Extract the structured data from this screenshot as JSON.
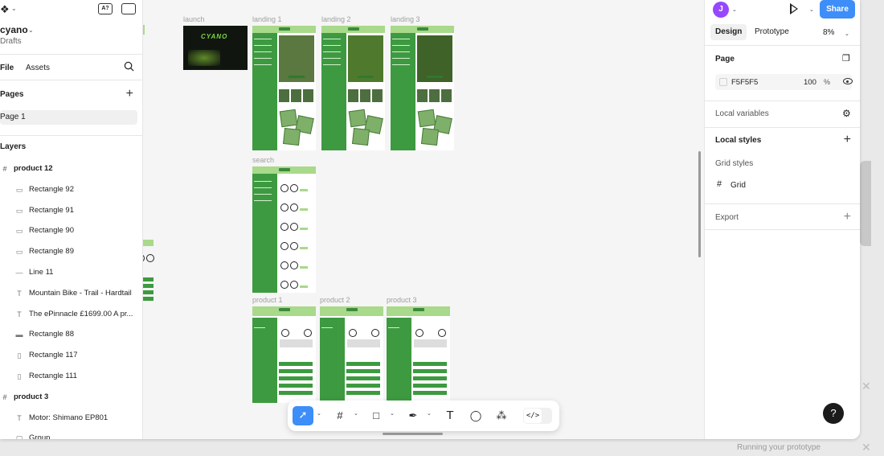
{
  "left": {
    "logo_glyph": "figma-logo",
    "file_name": "cyano",
    "file_location": "Drafts",
    "tabs": [
      "File",
      "Assets"
    ],
    "pages_heading": "Pages",
    "pages": [
      "Page 1"
    ],
    "layers_heading": "Layers",
    "layers": [
      {
        "kind": "frame",
        "icon": "#",
        "name": "product 12"
      },
      {
        "kind": "rect",
        "icon": "▭",
        "name": "Rectangle 92"
      },
      {
        "kind": "rect",
        "icon": "▭",
        "name": "Rectangle 91"
      },
      {
        "kind": "rect",
        "icon": "▭",
        "name": "Rectangle 90"
      },
      {
        "kind": "rect",
        "icon": "▭",
        "name": "Rectangle 89"
      },
      {
        "kind": "line",
        "icon": "—",
        "name": "Line 11"
      },
      {
        "kind": "text",
        "icon": "T",
        "name": "Mountain Bike - Trail - Hardtail"
      },
      {
        "kind": "text",
        "icon": "T",
        "name": "The ePinnacle £1699.00  A pr..."
      },
      {
        "kind": "rect",
        "icon": "▬",
        "name": "Rectangle 88"
      },
      {
        "kind": "rect",
        "icon": "▯",
        "name": "Rectangle 117"
      },
      {
        "kind": "rect",
        "icon": "▯",
        "name": "Rectangle 111"
      },
      {
        "kind": "frame",
        "icon": "#",
        "name": "product 3"
      },
      {
        "kind": "text",
        "icon": "T",
        "name": "Motor: Shimano EP801"
      },
      {
        "kind": "group",
        "icon": "▢",
        "name": "Group"
      }
    ]
  },
  "canvas": {
    "frames": {
      "launch": "launch",
      "landing1": "landing 1",
      "landing2": "landing 2",
      "landing3": "landing 3",
      "search": "search",
      "product1": "product 1",
      "product2": "product 2",
      "product3": "product 3"
    },
    "launch_logo": "CYANO"
  },
  "toolbar": {
    "tools": [
      "move-tool",
      "frame-tool",
      "shape-tool",
      "pen-tool",
      "text-tool",
      "comment-tool",
      "actions-tool"
    ],
    "dev_mode": "</>"
  },
  "right": {
    "avatar_initial": "J",
    "share_label": "Share",
    "tabs": [
      "Design",
      "Prototype"
    ],
    "zoom": "8%",
    "page_heading": "Page",
    "page_bg_hex": "F5F5F5",
    "page_bg_opacity": "100",
    "percent": "%",
    "local_variables": "Local variables",
    "local_styles": "Local styles",
    "grid_styles": "Grid styles",
    "grid_item": "Grid",
    "export": "Export"
  },
  "overlay": {
    "help_label": "?",
    "toast_text": "Running your prototype"
  },
  "colors": {
    "accent": "#3d8ef8",
    "brand_green": "#3d9a40",
    "light_green": "#a9d98a",
    "avatar": "#9747ff"
  }
}
